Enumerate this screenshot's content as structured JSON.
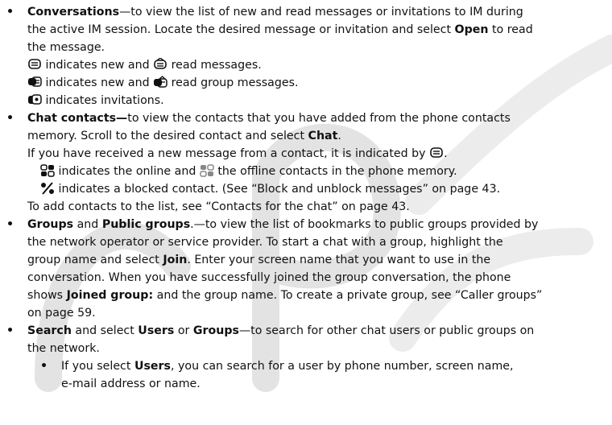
{
  "watermark": {
    "color": "#d3d3d3"
  },
  "items": {
    "conversations": {
      "lead": "Conversations",
      "text1": "—to view the list of new and read messages or invitations to IM during",
      "text2": "the active IM session. Locate the desired message or invitation and select ",
      "open": "Open",
      "text2b": " to read",
      "text3": "the message.",
      "line4": " indicates new and ",
      "line4b": " read messages.",
      "line5": "  indicates new and ",
      "line5b": " read group messages.",
      "line6": " indicates invitations."
    },
    "chat_contacts": {
      "lead": "Chat contacts—",
      "text1": "to view the contacts that you have added from the phone contacts",
      "text2": "memory. Scroll to the desired contact and select ",
      "chat": "Chat",
      "text2b": ".",
      "text3": "If you have received a new message from a contact, it is indicated by ",
      "text3b": ".",
      "line4": " indicates the online and ",
      "line4b": " the offline contacts in the phone memory.",
      "line5": " indicates a blocked contact. (See “Block and unblock messages” on page 43.",
      "line6": "To add contacts to the list, see “Contacts for the chat” on page 43."
    },
    "groups": {
      "lead1": "Groups",
      "and": " and ",
      "lead2": "Public groups",
      "text1": ".—to view the list of bookmarks to public groups provided by",
      "text2": "the network operator or service provider. To start a chat with a group, highlight the",
      "text3": "group name and select ",
      "join": "Join",
      "text3b": ". Enter your screen name that you want to use in the",
      "text4": "conversation. When you have successfully joined the group conversation, the phone",
      "text5": "shows ",
      "joined": "Joined group:",
      "text5b": " and the group name. To create a private group, see “Caller groups”",
      "text6": "on page 59."
    },
    "search": {
      "lead": "Search",
      "text1": " and select ",
      "users": "Users",
      "or": " or ",
      "groups": "Groups",
      "text1b": "—to search for other chat users or public groups on",
      "text2": "the network.",
      "sub_lead1": "If you select ",
      "sub_users": "Users",
      "sub_text1": ", you can search for a user by phone number, screen name,",
      "sub_text2": "e-mail address or name."
    }
  },
  "bullet_char": "•"
}
